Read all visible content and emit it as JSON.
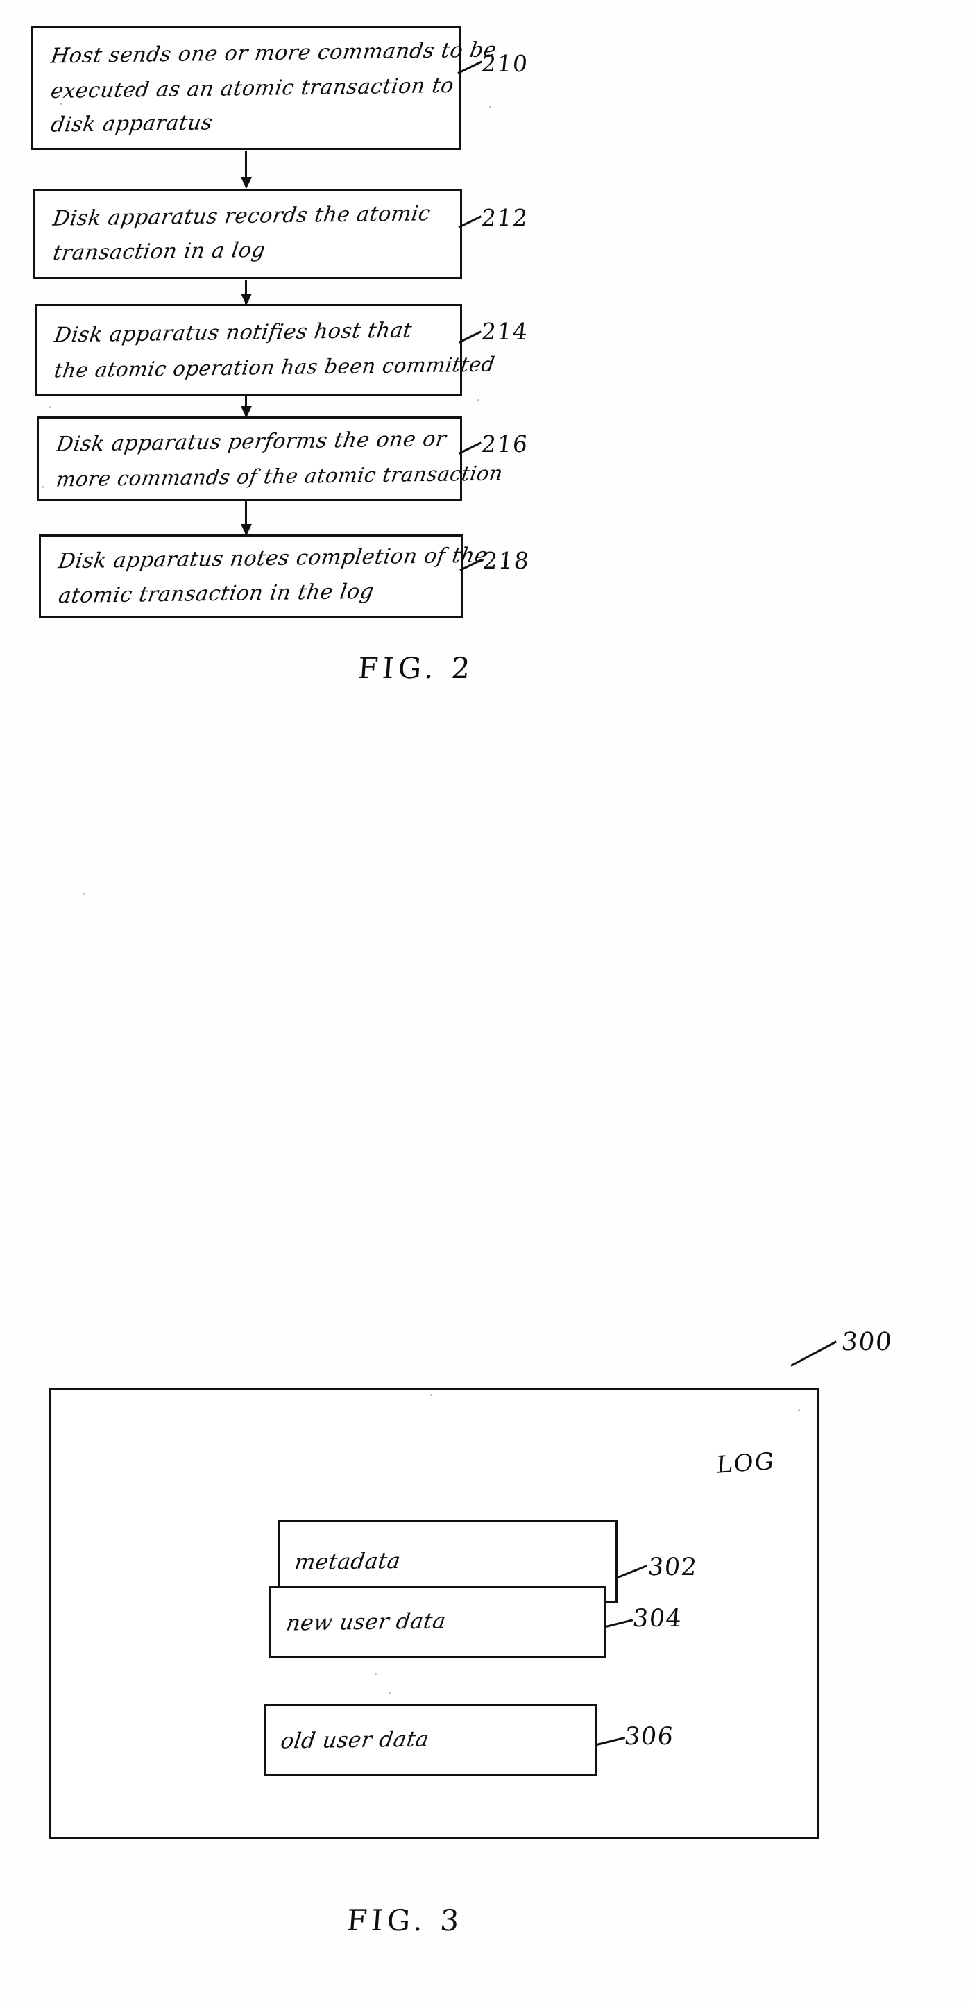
{
  "figures": [
    {
      "id": "fig2",
      "caption": "FIG. 2",
      "type": "flowchart",
      "steps": [
        {
          "ref": "210",
          "lines": [
            "Host sends one or more commands to be",
            "executed as an atomic transaction to",
            "disk apparatus"
          ]
        },
        {
          "ref": "212",
          "lines": [
            "Disk apparatus records the atomic",
            "transaction in a log"
          ]
        },
        {
          "ref": "214",
          "lines": [
            "Disk apparatus notifies host that",
            "the atomic operation has been committed"
          ]
        },
        {
          "ref": "216",
          "lines": [
            "Disk apparatus performs the one or",
            "more commands of the atomic transaction"
          ]
        },
        {
          "ref": "218",
          "lines": [
            "Disk apparatus notes completion of the",
            "atomic transaction in the log"
          ]
        }
      ]
    },
    {
      "id": "fig3",
      "caption": "FIG. 3",
      "type": "block-diagram",
      "container": {
        "ref": "300",
        "label": "LOG"
      },
      "blocks": [
        {
          "ref": "302",
          "label": "metadata"
        },
        {
          "ref": "304",
          "label": "new user data"
        },
        {
          "ref": "306",
          "label": "old user data"
        }
      ]
    }
  ],
  "colors": {
    "ink": "#0d0d0d",
    "paper": "#fefefe"
  }
}
